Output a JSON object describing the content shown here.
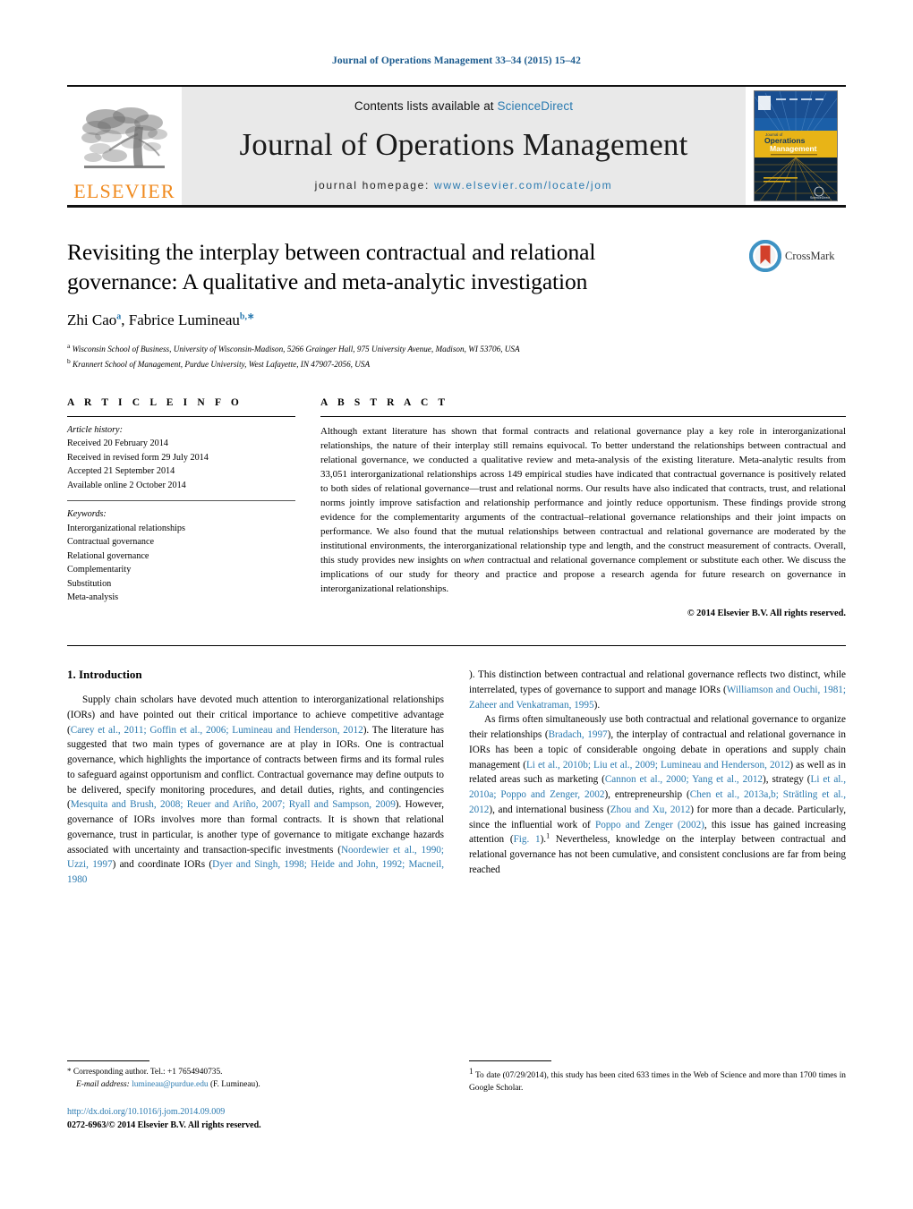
{
  "running_head": "Journal of Operations Management 33–34 (2015) 15–42",
  "masthead": {
    "publisher_name": "ELSEVIER",
    "contents_prefix": "Contents lists available at ",
    "contents_link": "ScienceDirect",
    "journal_title": "Journal of Operations Management",
    "homepage_prefix": "journal homepage: ",
    "homepage_url": "www.elsevier.com/locate/jom",
    "cover_title_line1": "Journal of",
    "cover_title_line2": "Operations",
    "cover_title_line3": "Management"
  },
  "title_block": {
    "title": "Revisiting the interplay between contractual and relational governance: A qualitative and meta-analytic investigation",
    "authors": "Zhi Cao",
    "author1_sup": "a",
    "author2": ", Fabrice Lumineau",
    "author2_sup": "b,∗",
    "affiliation_a_sup": "a",
    "affiliation_a": "Wisconsin School of Business, University of Wisconsin-Madison, 5266 Grainger Hall, 975 University Avenue, Madison, WI 53706, USA",
    "affiliation_b_sup": "b",
    "affiliation_b": "Krannert School of Management, Purdue University, West Lafayette, IN 47907-2056, USA",
    "crossmark_label": "CrossMark"
  },
  "article_info": {
    "heading": "A R T I C L E   I N F O",
    "history_label": "Article history:",
    "history": [
      "Received 20 February 2014",
      "Received in revised form 29 July 2014",
      "Accepted 21 September 2014",
      "Available online 2 October 2014"
    ],
    "keywords_label": "Keywords:",
    "keywords": [
      "Interorganizational relationships",
      "Contractual governance",
      "Relational governance",
      "Complementarity",
      "Substitution",
      "Meta-analysis"
    ]
  },
  "abstract": {
    "heading": "A B S T R A C T",
    "part1": "Although extant literature has shown that formal contracts and relational governance play a key role in interorganizational relationships, the nature of their interplay still remains equivocal. To better understand the relationships between contractual and relational governance, we conducted a qualitative review and meta-analysis of the existing literature. Meta-analytic results from 33,051 interorganizational relationships across 149 empirical studies have indicated that contractual governance is positively related to both sides of relational governance—trust and relational norms. Our results have also indicated that contracts, trust, and relational norms jointly improve satisfaction and relationship performance and jointly reduce opportunism. These findings provide strong evidence for the complementarity arguments of the contractual–relational governance relationships and their joint impacts on performance. We also found that the mutual relationships between contractual and relational governance are moderated by the institutional environments, the interorganizational relationship type and length, and the construct measurement of contracts. Overall, this study provides new insights on ",
    "emphasis": "when",
    "part2": " contractual and relational governance complement or substitute each other. We discuss the implications of our study for theory and practice and propose a research agenda for future research on governance in interorganizational relationships.",
    "copyright": "© 2014 Elsevier B.V. All rights reserved."
  },
  "body": {
    "section_number_title": "1.  Introduction",
    "left_p1_a": "Supply chain scholars have devoted much attention to interorganizational relationships (IORs) and have pointed out their critical importance to achieve competitive advantage (",
    "left_p1_ref1": "Carey et al., 2011; Goffin et al., 2006; Lumineau and Henderson, 2012",
    "left_p1_b": "). The literature has suggested that two main types of governance are at play in IORs. One is contractual governance, which highlights the importance of contracts between firms and its formal rules to safeguard against opportunism and conflict. Contractual governance may define outputs to be delivered, specify monitoring procedures, and detail duties, rights, and contingencies (",
    "left_p1_ref2": "Mesquita and Brush, 2008; Reuer and Ariño, 2007; Ryall and Sampson, 2009",
    "left_p1_c": "). However, governance of IORs involves more than formal contracts. It is shown that relational governance, trust in particular, is another type of governance to mitigate exchange hazards associated with uncertainty and transaction-specific investments (",
    "left_p1_ref3": "Noordewier et al., 1990; Uzzi, 1997",
    "left_p1_d": ") and coordinate IORs (",
    "left_p1_ref4": "Dyer and Singh, 1998; Heide and John, 1992; Macneil, 1980",
    "right_p1_a": "). This distinction between contractual and relational governance reflects two distinct, while interrelated, types of governance to support and manage IORs (",
    "right_p1_ref1": "Williamson and Ouchi, 1981; Zaheer and Venkatraman, 1995",
    "right_p1_b": ").",
    "right_p2_a": "As firms often simultaneously use both contractual and relational governance to organize their relationships (",
    "right_p2_ref1": "Bradach, 1997",
    "right_p2_b": "), the interplay of contractual and relational governance in IORs has been a topic of considerable ongoing debate in operations and supply chain management (",
    "right_p2_ref2": "Li et al., 2010b; Liu et al., 2009; Lumineau and Henderson, 2012",
    "right_p2_c": ") as well as in related areas such as marketing (",
    "right_p2_ref3": "Cannon et al., 2000; Yang et al., 2012",
    "right_p2_d": "), strategy (",
    "right_p2_ref4": "Li et al., 2010a; Poppo and Zenger, 2002",
    "right_p2_e": "), entrepreneurship (",
    "right_p2_ref5": "Chen et al., 2013a,b; Strätling et al., 2012",
    "right_p2_f": "), and international business (",
    "right_p2_ref6": "Zhou and Xu, 2012",
    "right_p2_g": ") for more than a decade. Particularly, since the influential work of ",
    "right_p2_ref7": "Poppo and Zenger (2002)",
    "right_p2_h": ", this issue has gained increasing attention (",
    "right_p2_ref8": "Fig. 1",
    "right_p2_i": ").",
    "right_p2_footmark": "1",
    "right_p2_j": " Nevertheless, knowledge on the interplay between contractual and relational governance has not been cumulative, and consistent conclusions are far from being reached"
  },
  "footnotes": {
    "corresponding_mark": "*",
    "corresponding_text": "Corresponding author. Tel.: +1 7654940735.",
    "email_label": "E-mail address:",
    "email": "lumineau@purdue.edu",
    "email_suffix": "(F. Lumineau).",
    "footnote1_mark": "1",
    "footnote1_text": "To date (07/29/2014), this study has been cited 633 times in the Web of Science and more than 1700 times in Google Scholar.",
    "doi_url": "http://dx.doi.org/10.1016/j.jom.2014.09.009",
    "issn_line": "0272-6963/© 2014 Elsevier B.V. All rights reserved."
  },
  "colors": {
    "link_blue": "#2a7ab0",
    "elsevier_orange": "#f08a1e",
    "running_head_blue": "#1a5a8e",
    "masthead_grey": "#e9e9e9"
  }
}
